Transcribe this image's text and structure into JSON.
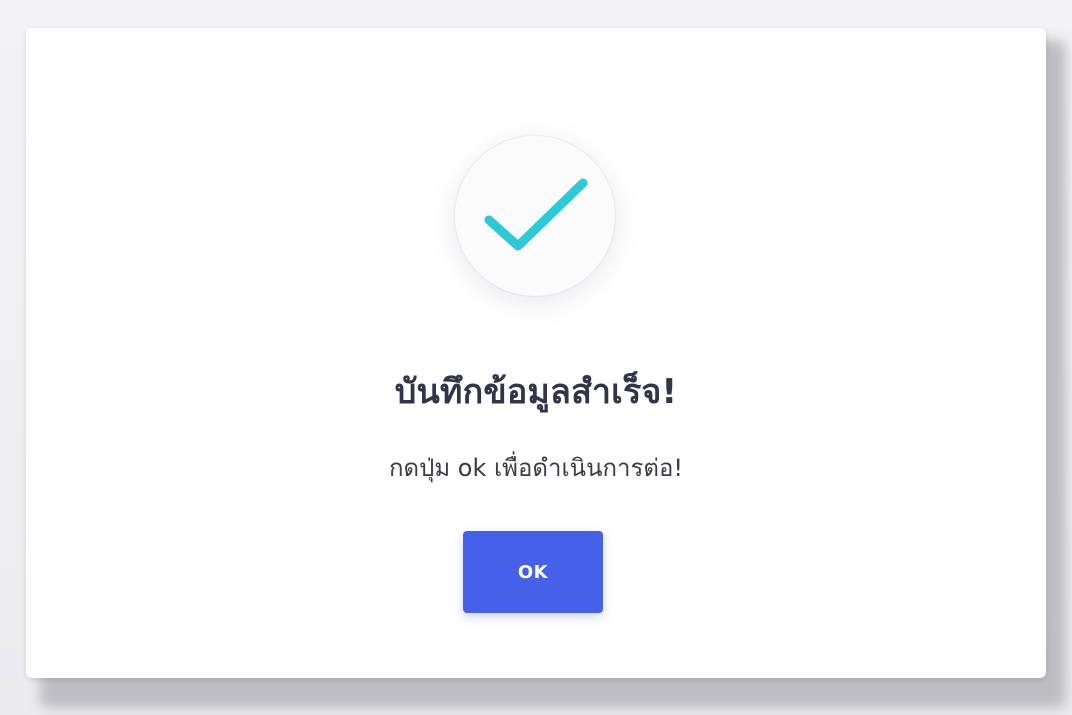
{
  "dialog": {
    "title": "บันทึกข้อมูลสำเร็จ!",
    "message": "กดปุ่ม ok เพื่อดำเนินการต่อ!",
    "ok_label": "OK",
    "icon": "check-icon"
  },
  "colors": {
    "check": "#2ec9d6",
    "button": "#4661e8",
    "title": "#33334a"
  }
}
